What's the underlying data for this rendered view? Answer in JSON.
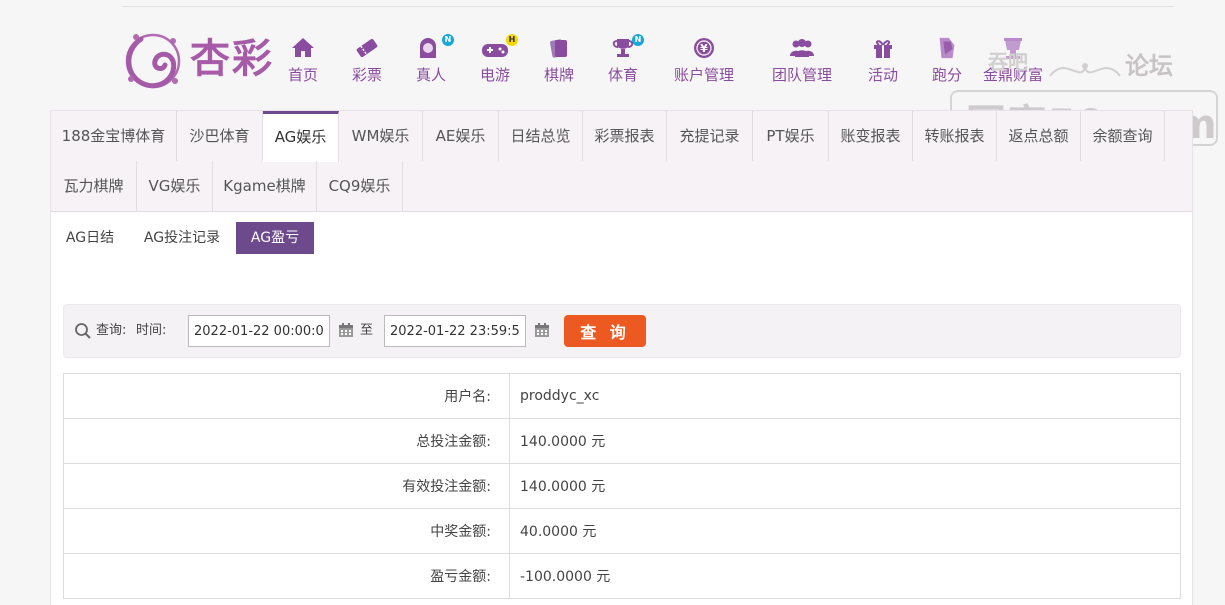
{
  "brand": {
    "logo_text": "杏彩"
  },
  "nav": [
    {
      "label": "首页",
      "icon": "home-icon"
    },
    {
      "label": "彩票",
      "icon": "lottery-ticket-icon"
    },
    {
      "label": "真人",
      "icon": "live-dealer-icon",
      "badge": "N"
    },
    {
      "label": "电游",
      "icon": "gamepad-icon",
      "badge": "H"
    },
    {
      "label": "棋牌",
      "icon": "cards-icon"
    },
    {
      "label": "体育",
      "icon": "trophy-icon",
      "badge": "N"
    },
    {
      "label": "账户管理",
      "icon": "yen-coin-icon"
    },
    {
      "label": "团队管理",
      "icon": "team-icon"
    },
    {
      "label": "活动",
      "icon": "gift-icon"
    },
    {
      "label": "跑分",
      "icon": "runner-icon"
    },
    {
      "label": "金鼎财富",
      "icon": "wealth-icon"
    }
  ],
  "watermark": {
    "line0": "吞吧",
    "line1": "论坛",
    "line2": "回家50.com"
  },
  "tabs_row1": [
    "188金宝博体育",
    "沙巴体育",
    "AG娱乐",
    "WM娱乐",
    "AE娱乐",
    "日结总览",
    "彩票报表",
    "充提记录",
    "PT娱乐",
    "账变报表",
    "转账报表",
    "返点总额",
    "余额查询"
  ],
  "tabs_row2": [
    "瓦力棋牌",
    "VG娱乐",
    "Kgame棋牌",
    "CQ9娱乐"
  ],
  "active_tab": "AG娱乐",
  "subtabs": [
    "AG日结",
    "AG投注记录",
    "AG盈亏"
  ],
  "active_subtab": "AG盈亏",
  "query": {
    "label_query": "查询:",
    "label_time": "时间:",
    "start": "2022-01-22 00:00:00",
    "to": "至",
    "end": "2022-01-22 23:59:59",
    "button": "查 询"
  },
  "result": {
    "username_label": "用户名:",
    "username": "proddyc_xc",
    "total_bet_label": "总投注金额:",
    "total_bet": "140.0000 元",
    "valid_bet_label": "有效投注金额:",
    "valid_bet": "140.0000 元",
    "win_label": "中奖金额:",
    "win": "40.0000 元",
    "profit_label": "盈亏金额:",
    "profit": "-100.0000 元"
  },
  "colors": {
    "brand_purple": "#8a4c9e",
    "tab_active": "#6c4a8c",
    "query_button": "#ec5a22"
  }
}
